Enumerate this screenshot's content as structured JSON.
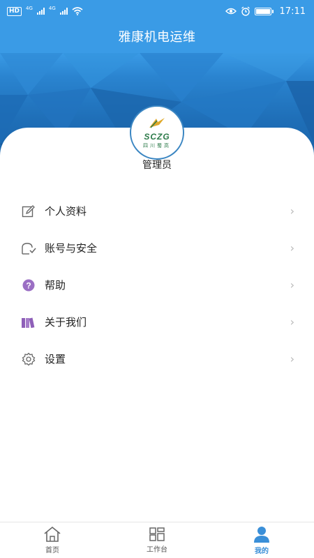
{
  "status_bar": {
    "left_badges": [
      "HD",
      "4G",
      "4G"
    ],
    "time": "17:11",
    "battery_level": 1.0
  },
  "header": {
    "title": "雅康机电运维"
  },
  "profile": {
    "logo_text": "SCZG",
    "logo_subtext": "四川蜀高",
    "username": "管理员"
  },
  "menu": {
    "items": [
      {
        "label": "个人资料",
        "icon": "edit-icon"
      },
      {
        "label": "账号与安全",
        "icon": "account-security-icon"
      },
      {
        "label": "帮助",
        "icon": "help-icon"
      },
      {
        "label": "关于我们",
        "icon": "books-icon"
      },
      {
        "label": "设置",
        "icon": "gear-icon"
      }
    ],
    "chevron": "›"
  },
  "tabbar": {
    "tabs": [
      {
        "label": "首页",
        "icon": "home-icon",
        "active": false
      },
      {
        "label": "工作台",
        "icon": "workbench-icon",
        "active": false
      },
      {
        "label": "我的",
        "icon": "user-icon",
        "active": true
      }
    ]
  },
  "colors": {
    "primary": "#3a9be6",
    "active_tab": "#3a8fd8",
    "help_icon": "#9b6fc4",
    "books_icon": "#8e5fb8"
  }
}
